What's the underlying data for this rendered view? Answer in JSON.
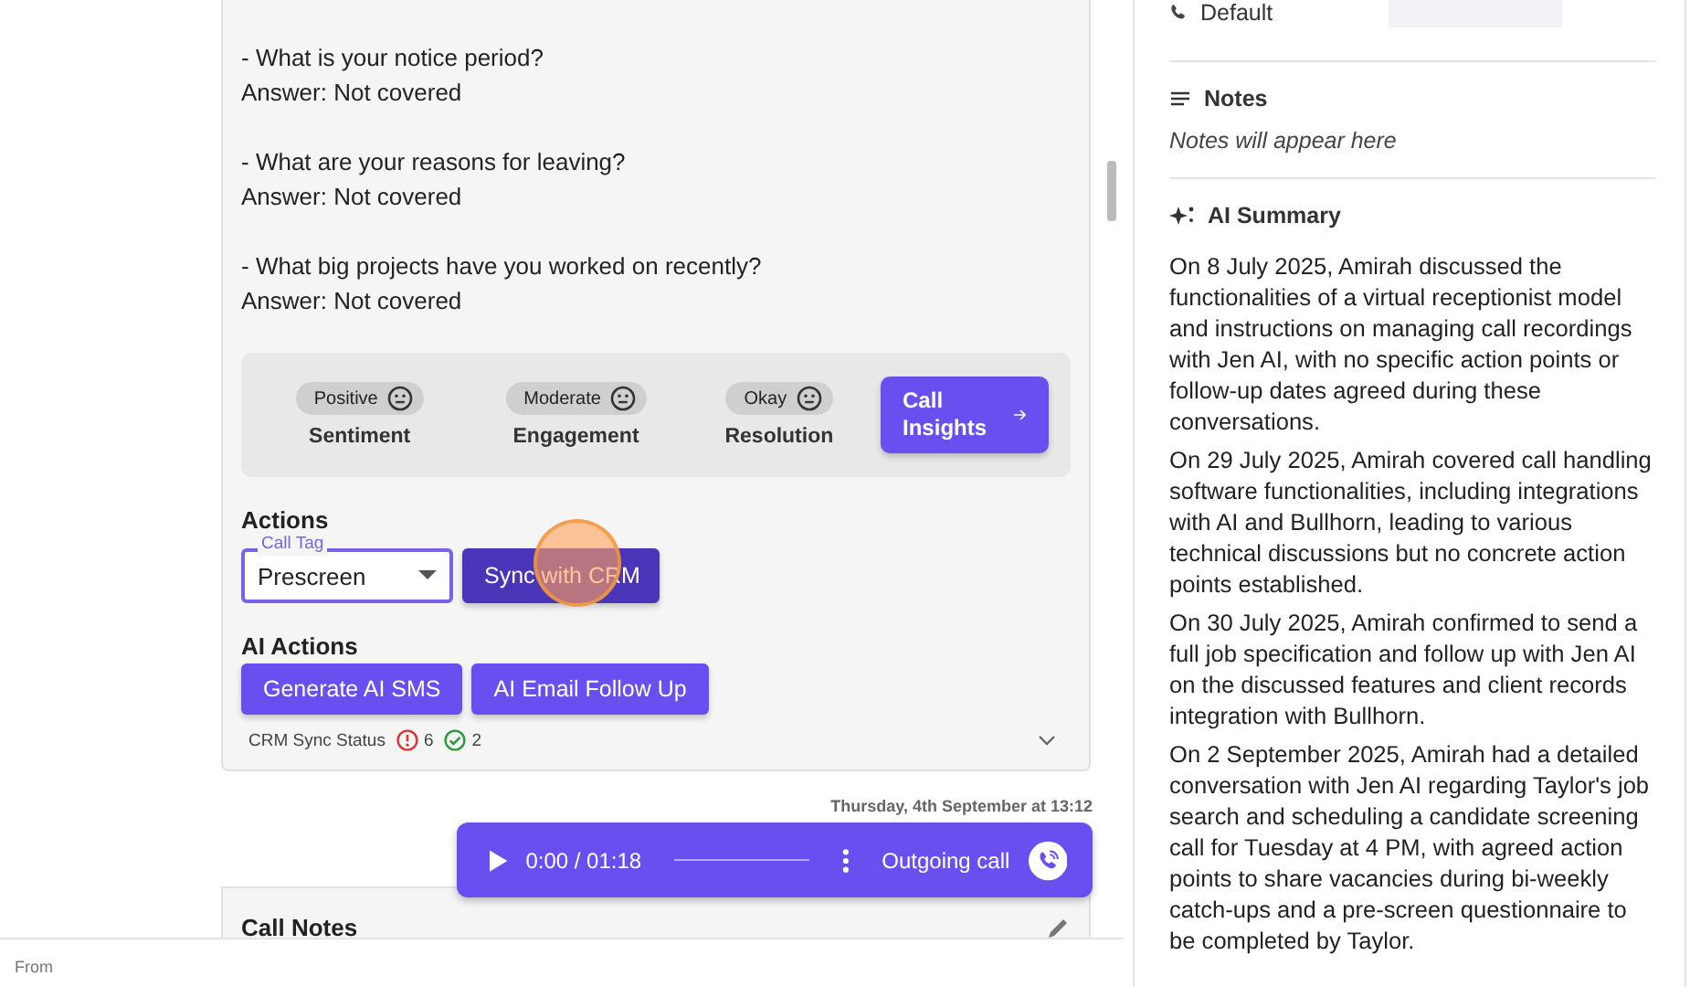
{
  "qa": [
    {
      "question": "- What is your notice period?",
      "answer": "Answer: Not covered"
    },
    {
      "question": "- What are your reasons for leaving?",
      "answer": "Answer: Not covered"
    },
    {
      "question": "- What big projects have you worked on recently?",
      "answer": "Answer: Not covered"
    }
  ],
  "metrics": [
    {
      "value": "Positive",
      "label": "Sentiment"
    },
    {
      "value": "Moderate",
      "label": "Engagement"
    },
    {
      "value": "Okay",
      "label": "Resolution"
    }
  ],
  "insights_button": "Call Insights",
  "actions": {
    "title": "Actions",
    "call_tag": {
      "label": "Call Tag",
      "value": "Prescreen"
    },
    "sync_button": "Sync with CRM"
  },
  "ai_actions": {
    "title": "AI Actions",
    "buttons": [
      "Generate AI SMS",
      "AI Email Follow Up"
    ]
  },
  "crm_sync": {
    "label": "CRM Sync Status",
    "errors": "6",
    "synced": "2",
    "expanded": false
  },
  "call": {
    "date": "Thursday, 4th September at 13:12",
    "time": "0:00 / 01:18",
    "direction": "Outgoing call"
  },
  "call_notes": {
    "title": "Call Notes"
  },
  "bottom_bar": {
    "label": "From"
  },
  "sidebar": {
    "phone": "Default",
    "notes_title": "Notes",
    "notes_placeholder": "Notes will appear here",
    "summary_title": "AI Summary",
    "summary": [
      "On 8 July 2025, Amirah discussed the functionalities of a virtual receptionist model and instructions on managing call recordings with Jen AI, with no specific action points or follow-up dates agreed during these conversations.",
      "On 29 July 2025, Amirah covered call handling software functionalities, including integrations with AI and Bullhorn, leading to various technical discussions but no concrete action points established.",
      "On 30 July 2025, Amirah confirmed to send a full job specification and follow up with Jen AI on the discussed features and client records integration with Bullhorn.",
      "On 2 September 2025, Amirah had a detailed conversation with Jen AI regarding Taylor's job search and scheduling a candidate screening call for Tuesday at 4 PM, with agreed action points to share vacancies during bi-weekly catch-ups and a pre-screen questionnaire to be completed by Taylor."
    ]
  }
}
